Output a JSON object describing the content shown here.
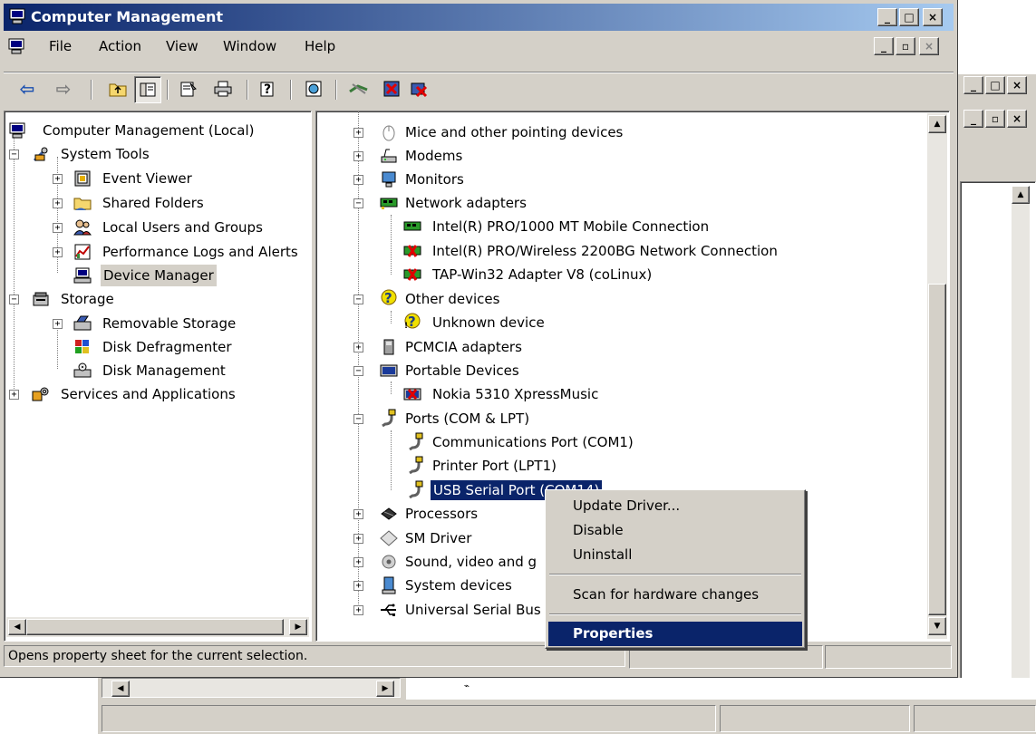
{
  "window": {
    "title": "Computer Management",
    "caption_buttons": [
      "_",
      "□",
      "×"
    ],
    "mdi_buttons": [
      "_",
      "▫",
      "×"
    ]
  },
  "menu": {
    "items": [
      "File",
      "Action",
      "View",
      "Window",
      "Help"
    ]
  },
  "toolbar": {
    "buttons": [
      "back-icon",
      "forward-icon",
      "up-icon",
      "show-hide-tree-icon",
      "properties-icon",
      "print-icon",
      "help-icon",
      "scan-icon",
      "update-driver-icon",
      "disable-icon",
      "uninstall-icon"
    ]
  },
  "tree": {
    "root": "Computer Management (Local)",
    "system_tools": "System Tools",
    "event_viewer": "Event Viewer",
    "shared_folders": "Shared Folders",
    "local_users": "Local Users and Groups",
    "perf_logs": "Performance Logs and Alerts",
    "device_manager": "Device Manager",
    "storage": "Storage",
    "removable_storage": "Removable Storage",
    "disk_defrag": "Disk Defragmenter",
    "disk_mgmt": "Disk Management",
    "services": "Services and Applications"
  },
  "devices": {
    "mice": "Mice and other pointing devices",
    "modems": "Modems",
    "monitors": "Monitors",
    "network": "Network adapters",
    "net1": "Intel(R) PRO/1000 MT Mobile Connection",
    "net2": "Intel(R) PRO/Wireless 2200BG Network Connection",
    "net3": "TAP-Win32 Adapter V8 (coLinux)",
    "other": "Other devices",
    "unknown": "Unknown device",
    "pcmcia": "PCMCIA adapters",
    "portable": "Portable Devices",
    "nokia": "Nokia 5310 XpressMusic",
    "ports": "Ports (COM & LPT)",
    "com1": "Communications Port (COM1)",
    "lpt1": "Printer Port (LPT1)",
    "usbserial": "USB Serial Port (COM14)",
    "processors": "Processors",
    "smdriver": "SM Driver",
    "sound": "Sound, video and g",
    "system": "System devices",
    "usb": "Universal Serial Bus"
  },
  "context_menu": {
    "update": "Update Driver...",
    "disable": "Disable",
    "uninstall": "Uninstall",
    "scan": "Scan for hardware changes",
    "properties": "Properties"
  },
  "status": {
    "text": "Opens property sheet for the current selection."
  },
  "colors": {
    "titlebar_start": "#0a246a",
    "titlebar_end": "#a6caf0",
    "face": "#d4d0c8",
    "selection": "#0a246a"
  }
}
